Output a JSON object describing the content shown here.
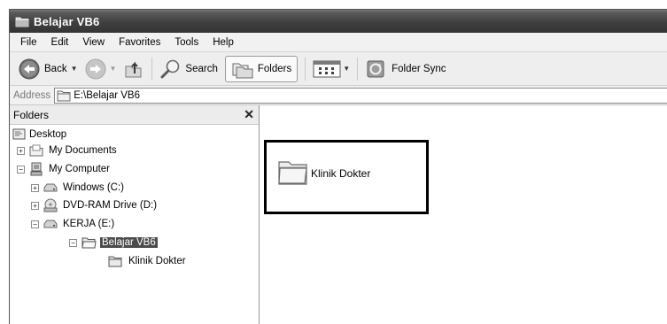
{
  "window": {
    "title": "Belajar VB6"
  },
  "menu": [
    "File",
    "Edit",
    "View",
    "Favorites",
    "Tools",
    "Help"
  ],
  "toolbar": {
    "back": "Back",
    "search": "Search",
    "folders": "Folders",
    "folder_sync": "Folder Sync"
  },
  "address": {
    "label": "Address",
    "value": "E:\\Belajar VB6"
  },
  "folders_pane": {
    "header": "Folders",
    "tree": [
      {
        "label": "Desktop"
      },
      {
        "label": "My Documents"
      },
      {
        "label": "My Computer"
      },
      {
        "label": "Windows (C:)"
      },
      {
        "label": "DVD-RAM Drive (D:)"
      },
      {
        "label": "KERJA (E:)"
      },
      {
        "label": "Belajar VB6"
      },
      {
        "label": "Klinik Dokter"
      }
    ]
  },
  "content": {
    "items": [
      {
        "label": "Klinik Dokter"
      }
    ]
  },
  "colors": {
    "titlebar": "#3f3f3f",
    "selection": "#4b4b4b",
    "highlight_border": "#000000"
  },
  "icons": [
    "explorer-window-icon",
    "back-arrow-icon",
    "forward-arrow-icon",
    "up-folder-icon",
    "search-magnifier-icon",
    "folders-icon",
    "views-icon",
    "folder-sync-icon",
    "folder-icon",
    "desktop-icon",
    "my-documents-icon",
    "my-computer-icon",
    "drive-icon",
    "dvd-drive-icon"
  ]
}
